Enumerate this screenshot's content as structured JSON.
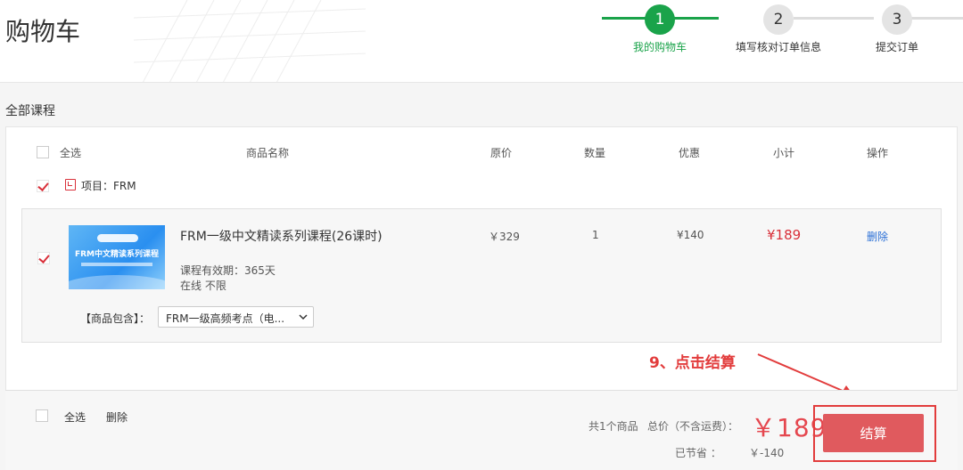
{
  "header": {
    "title": "购物车",
    "steps": [
      {
        "number": "1",
        "label": "我的购物车",
        "state": "active"
      },
      {
        "number": "2",
        "label": "填写核对订单信息",
        "state": "idle"
      },
      {
        "number": "3",
        "label": "提交订单",
        "state": "idle"
      }
    ]
  },
  "section_title": "全部课程",
  "table": {
    "select_all": "全选",
    "columns": [
      "商品名称",
      "原价",
      "数量",
      "优惠",
      "小计",
      "操作"
    ]
  },
  "project": {
    "label": "项目：FRM",
    "checked": true
  },
  "items": [
    {
      "checked": true,
      "thumbnail_text": "FRM中文精读系列课程",
      "name": "FRM一级中文精读系列课程(26课时)",
      "validity": "课程有效期：365天",
      "mode": "在线  不限",
      "original_price": "￥329",
      "quantity": "1",
      "discount": "¥140",
      "subtotal": "¥189",
      "action": "删除",
      "includes_label": "【商品包含】：",
      "includes_value": "FRM一级高频考点（电..."
    }
  ],
  "annotation": "9、点击结算",
  "footer": {
    "select_all": "全选",
    "delete": "删除",
    "count": "共1个商品",
    "total_label": "总价（不含运费）：",
    "total_price": "￥189",
    "saved_label": "已节省 ：",
    "saved_value": "￥-140",
    "checkout": "结算"
  },
  "colors": {
    "accent_green": "#1aa34a",
    "price_red": "#d9303a",
    "checkout_button": "#e05a5e",
    "annotation_red": "#e23c3c",
    "link_blue": "#2a6fd6"
  }
}
